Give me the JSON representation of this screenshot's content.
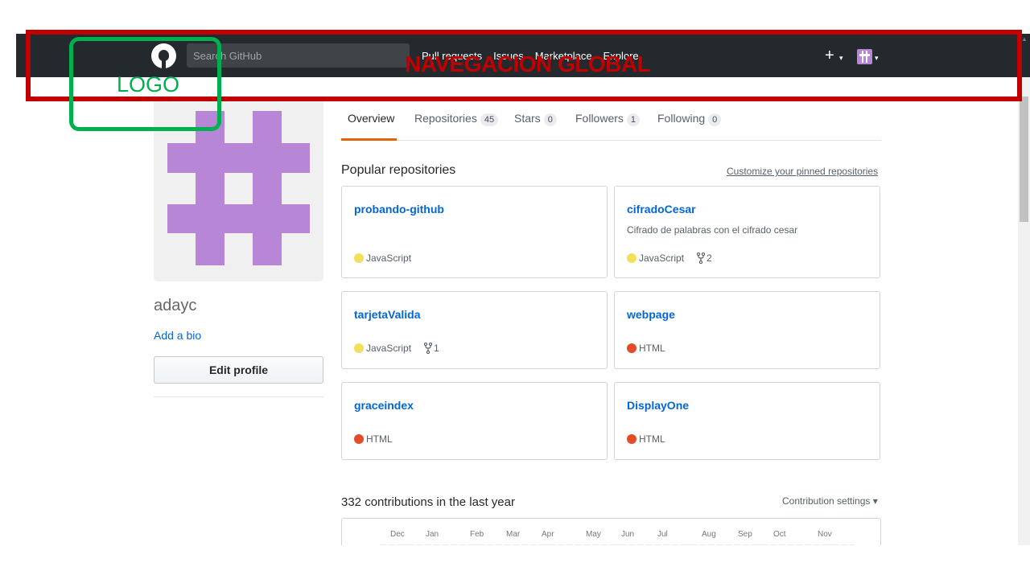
{
  "header": {
    "search_placeholder": "Search GitHub",
    "nav": [
      "Pull requests",
      "Issues",
      "Marketplace",
      "Explore"
    ],
    "plus": "+",
    "caret": "▾"
  },
  "annotations": {
    "global_nav_label": "NAVEGACION GLOBAL",
    "logo_label": "LOGO",
    "global_nav_color": "#c00000",
    "logo_color": "#00b050"
  },
  "profile": {
    "username": "adayc",
    "add_bio": "Add a bio",
    "edit_profile": "Edit profile",
    "avatar_color": "#b786d6"
  },
  "tabs": [
    {
      "label": "Overview",
      "count": ""
    },
    {
      "label": "Repositories",
      "count": "45"
    },
    {
      "label": "Stars",
      "count": "0"
    },
    {
      "label": "Followers",
      "count": "1"
    },
    {
      "label": "Following",
      "count": "0"
    }
  ],
  "popular": {
    "title": "Popular repositories",
    "customize": "Customize your pinned repositories",
    "repos": [
      {
        "name": "probando-github",
        "desc": "",
        "lang": "JavaScript",
        "lang_color": "#f1e05a",
        "forks": ""
      },
      {
        "name": "cifradoCesar",
        "desc": "Cifrado de palabras con el cifrado cesar",
        "lang": "JavaScript",
        "lang_color": "#f1e05a",
        "forks": "2"
      },
      {
        "name": "tarjetaValida",
        "desc": "",
        "lang": "JavaScript",
        "lang_color": "#f1e05a",
        "forks": "1"
      },
      {
        "name": "webpage",
        "desc": "",
        "lang": "HTML",
        "lang_color": "#e34c26",
        "forks": ""
      },
      {
        "name": "graceindex",
        "desc": "",
        "lang": "HTML",
        "lang_color": "#e34c26",
        "forks": ""
      },
      {
        "name": "DisplayOne",
        "desc": "",
        "lang": "HTML",
        "lang_color": "#e34c26",
        "forks": ""
      }
    ]
  },
  "contributions": {
    "title": "332 contributions in the last year",
    "settings": "Contribution settings ▾",
    "months": [
      "Dec",
      "Jan",
      "Feb",
      "Mar",
      "Apr",
      "May",
      "Jun",
      "Jul",
      "Aug",
      "Sep",
      "Oct",
      "Nov"
    ]
  }
}
